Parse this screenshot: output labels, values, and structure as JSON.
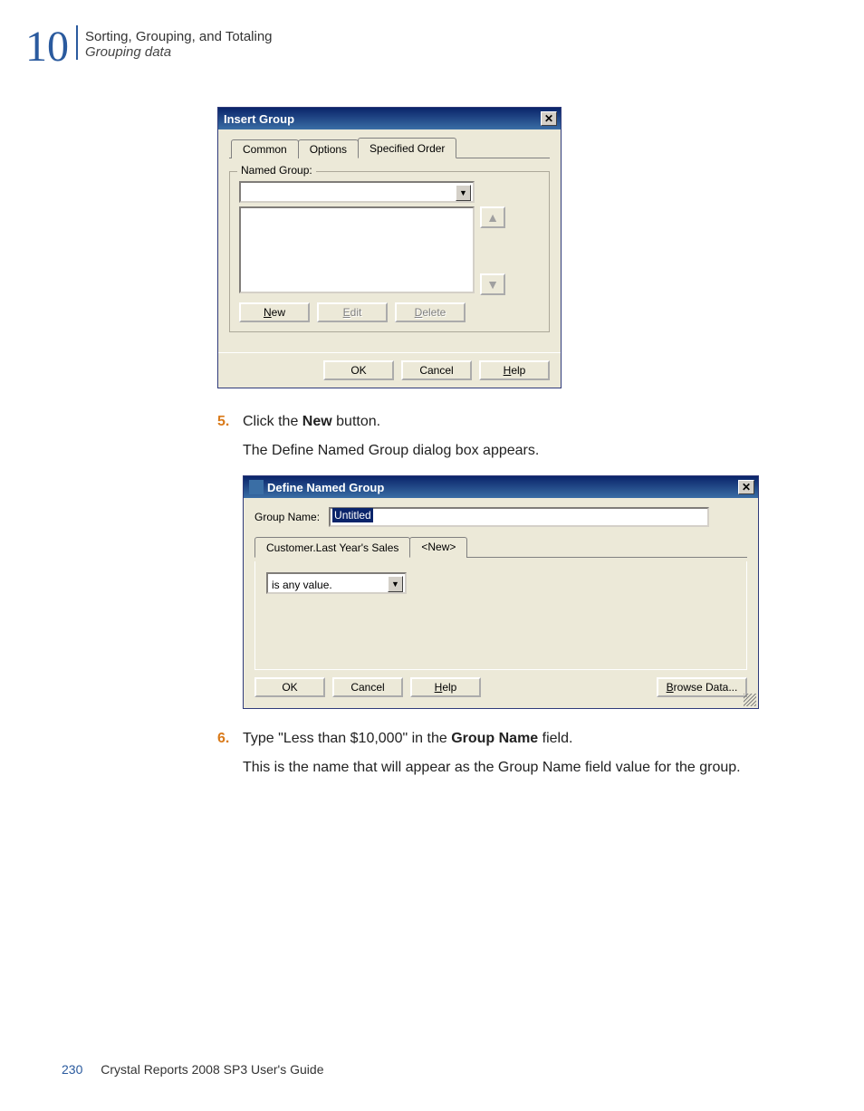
{
  "chapter": {
    "number": "10",
    "title": "Sorting, Grouping, and Totaling",
    "subtitle": "Grouping data"
  },
  "dialog1": {
    "title": "Insert Group",
    "close_icon": "✕",
    "tabs": [
      {
        "label": "Common"
      },
      {
        "label": "Options"
      },
      {
        "label": "Specified Order"
      }
    ],
    "legend": "Named Group:",
    "up_icon": "▲",
    "down_icon": "▼",
    "combo_arrow": "▼",
    "buttons": {
      "new": "New",
      "new_u": "N",
      "edit": "Edit",
      "edit_u": "E",
      "delete": "Delete",
      "delete_u": "D",
      "ok": "OK",
      "cancel": "Cancel",
      "help": "Help",
      "help_u": "H"
    }
  },
  "step5": {
    "num": "5.",
    "text_pre": "Click the ",
    "text_bold": "New",
    "text_post": " button.",
    "body": "The Define Named Group dialog box appears."
  },
  "dialog2": {
    "title": "Define Named Group",
    "close_icon": "✕",
    "groupname_label": "Group Name:",
    "groupname_value": "Untitled",
    "tabs": [
      {
        "label": "Customer.Last Year's Sales"
      },
      {
        "label": "<New>"
      }
    ],
    "condition": "is any value.",
    "buttons": {
      "ok": "OK",
      "cancel": "Cancel",
      "help": "Help",
      "help_u": "H",
      "browse": "Browse Data...",
      "browse_u": "B"
    }
  },
  "step6": {
    "num": "6.",
    "text_pre": "Type \"Less than $10,000\" in the ",
    "text_bold": "Group Name",
    "text_post": " field.",
    "body": "This is the name that will appear as the Group Name field value for the group."
  },
  "footer": {
    "page": "230",
    "guide": "Crystal Reports 2008 SP3 User's Guide"
  }
}
